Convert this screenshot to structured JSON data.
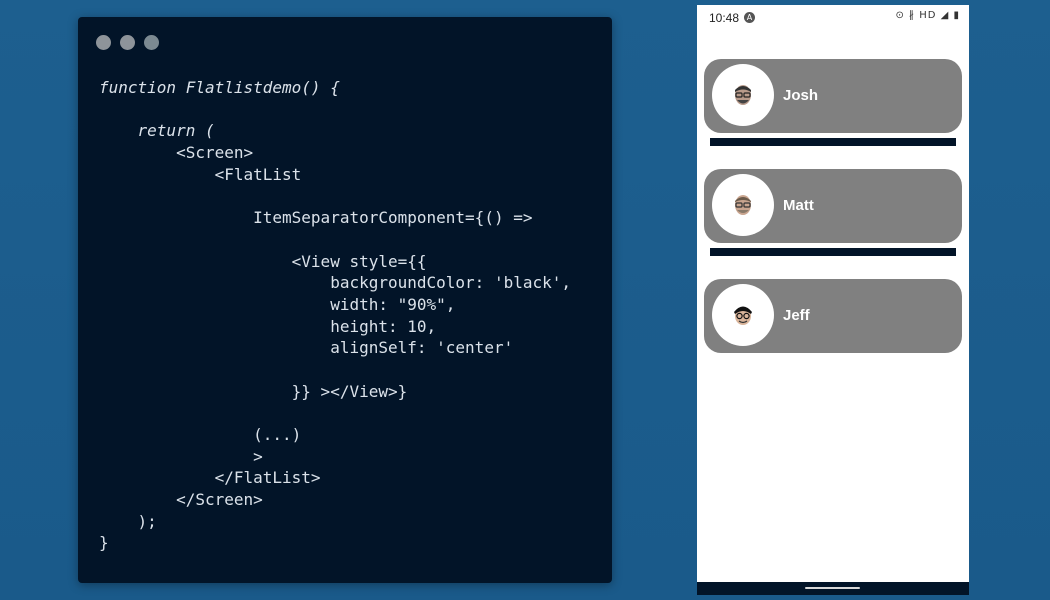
{
  "code": {
    "lines": [
      "function Flatlistdemo() {",
      "",
      "    return (",
      "        <Screen>",
      "            <FlatList",
      "",
      "                ItemSeparatorComponent={() =>",
      "",
      "                    <View style={{",
      "                        backgroundColor: 'black',",
      "                        width: \"90%\",",
      "                        height: 10,",
      "                        alignSelf: 'center'",
      "",
      "                    }} ></View>}",
      "",
      "                (...)",
      "                >",
      "            </FlatList>",
      "        </Screen>",
      "    );",
      "}"
    ]
  },
  "phone": {
    "time": "10:48",
    "app_badge": "A",
    "status_icons": "⊙ ∦ HD ◢ ▮",
    "items": [
      {
        "name": "Josh",
        "avatar_icon": "memoji-josh-icon"
      },
      {
        "name": "Matt",
        "avatar_icon": "memoji-matt-icon"
      },
      {
        "name": "Jeff",
        "avatar_icon": "memoji-jeff-icon"
      }
    ]
  },
  "colors": {
    "background": "#1d5f8f",
    "code_bg": "#021428",
    "item_bg": "#808080",
    "separator": "#021428"
  }
}
